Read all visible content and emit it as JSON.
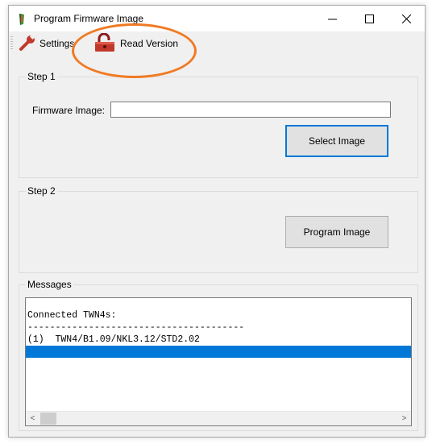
{
  "window": {
    "title": "Program Firmware Image",
    "minimize_glyph": "—",
    "maximize_glyph": "☐",
    "close_glyph": "✕"
  },
  "toolbar": {
    "settings_label": "Settings",
    "settings_icon": "wrench-icon",
    "read_version_label": "Read Version",
    "read_version_icon": "unlocked-padlock-icon"
  },
  "step1": {
    "label": "Step 1",
    "firmware_label": "Firmware Image:",
    "firmware_value": "",
    "select_button": "Select Image"
  },
  "step2": {
    "label": "Step 2",
    "program_button": "Program Image"
  },
  "messages": {
    "label": "Messages",
    "lines": [
      "",
      "Connected TWN4s:",
      "---------------------------------------",
      "(1)  TWN4/B1.09/NKL3.12/STD2.02",
      ""
    ],
    "selected_index": 4,
    "scroll_left": "<",
    "scroll_right": ">"
  },
  "colors": {
    "highlight": "#f07a24",
    "selection": "#0078d7"
  }
}
